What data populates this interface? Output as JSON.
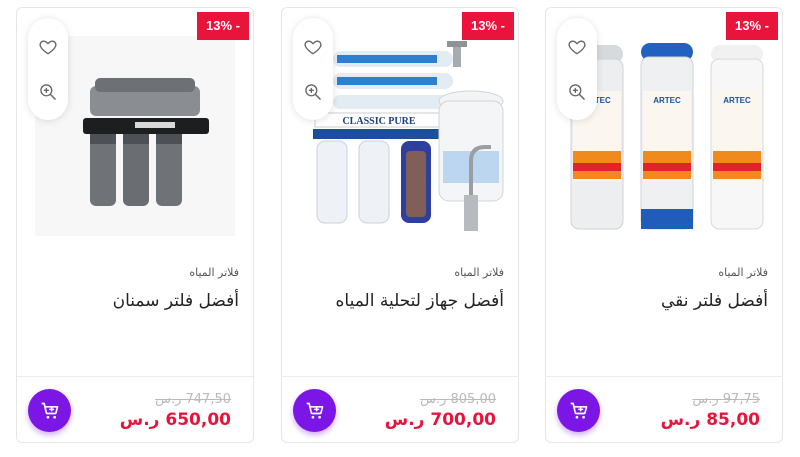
{
  "products": [
    {
      "discount": "13% -",
      "category": "فلاتر المياه",
      "title": "أفضل فلتر سمنان",
      "old_price": "747,50 ر.س",
      "new_price": "650,00 ر.س",
      "image": "multi-stage-filter-system"
    },
    {
      "discount": "13% -",
      "category": "فلاتر المياه",
      "title": "أفضل جهاز لتحلية المياه",
      "old_price": "805,00 ر.س",
      "new_price": "700,00 ر.س",
      "image": "ro-desalination-unit",
      "image_text": "CLASSIC PURE"
    },
    {
      "discount": "13% -",
      "category": "فلاتر المياه",
      "title": "أفضل فلتر نقي",
      "old_price": "97,75 ر.س",
      "new_price": "85,00 ر.س",
      "image": "filter-cartridges",
      "image_text": "ARTEC"
    }
  ],
  "colors": {
    "badge": "#e8143c",
    "price": "#e8143c",
    "cart_button": "#7b16e6"
  },
  "icons": [
    "heart-icon",
    "zoom-in-icon",
    "cart-icon"
  ]
}
